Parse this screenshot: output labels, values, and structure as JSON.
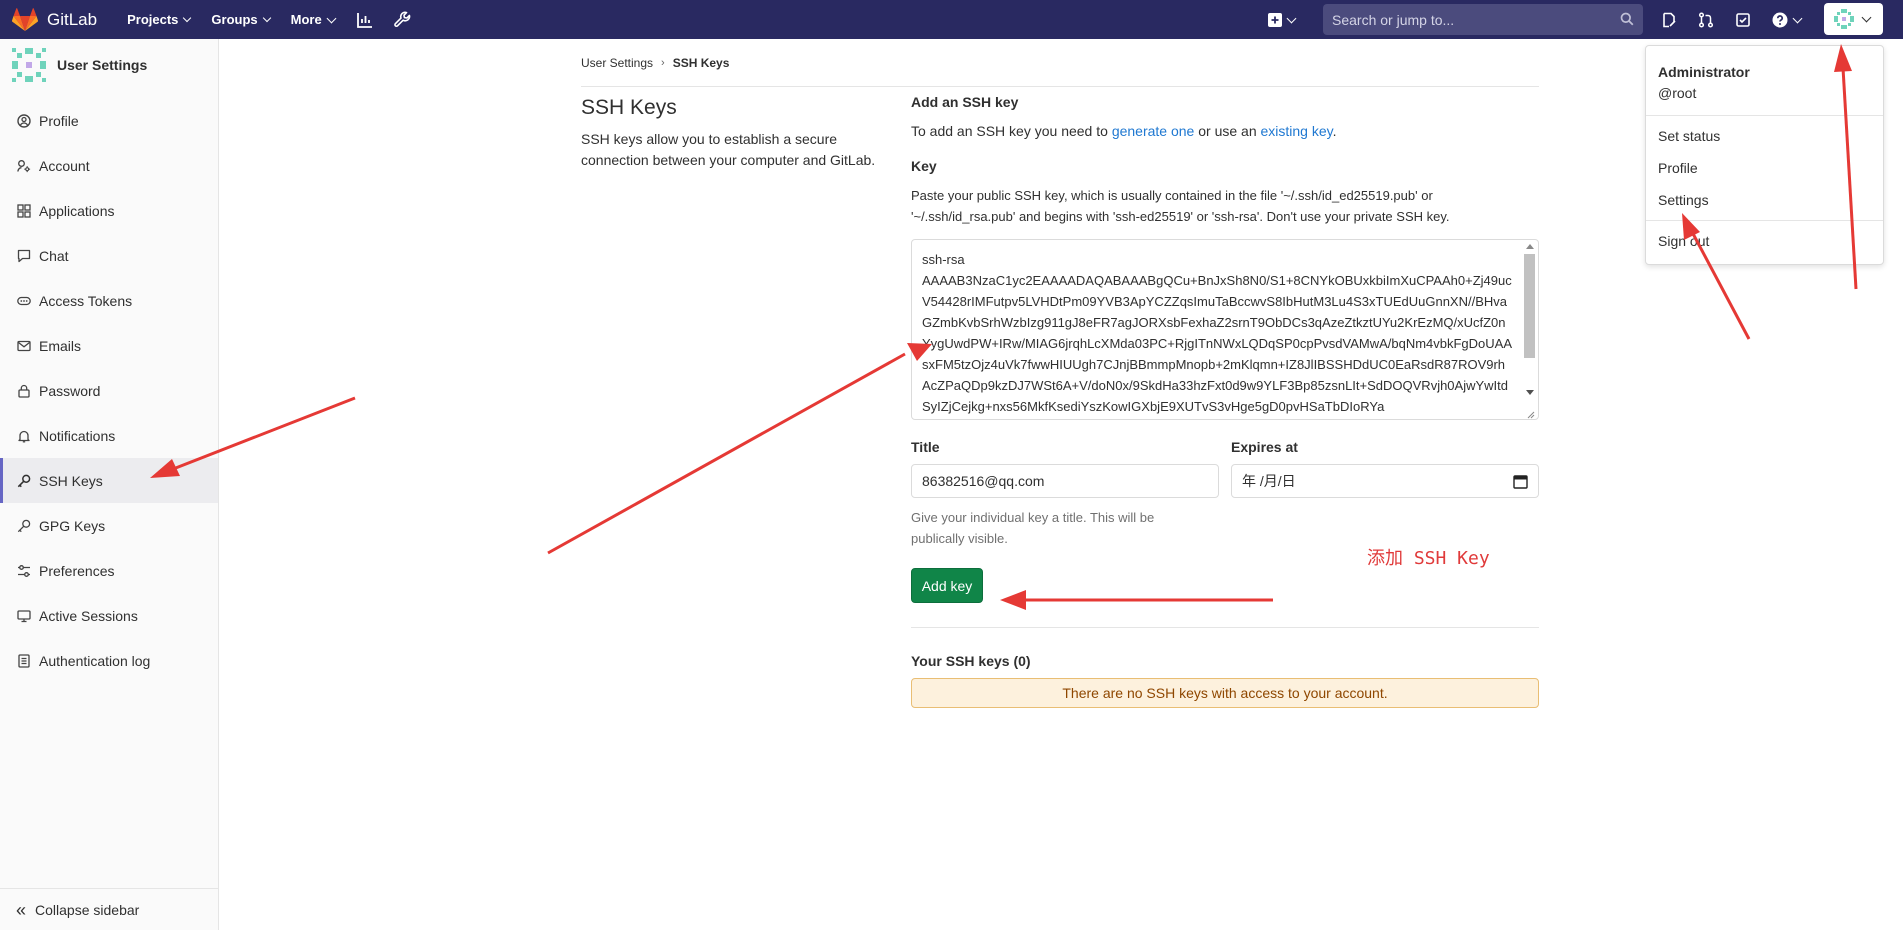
{
  "navbar": {
    "brand": "GitLab",
    "menu": [
      {
        "label": "Projects"
      },
      {
        "label": "Groups"
      },
      {
        "label": "More"
      }
    ],
    "search_placeholder": "Search or jump to...",
    "accent": "#292961"
  },
  "sidebar": {
    "title": "User Settings",
    "items": [
      {
        "label": "Profile",
        "icon": "profile-icon"
      },
      {
        "label": "Account",
        "icon": "account-icon"
      },
      {
        "label": "Applications",
        "icon": "applications-icon"
      },
      {
        "label": "Chat",
        "icon": "chat-icon"
      },
      {
        "label": "Access Tokens",
        "icon": "token-icon"
      },
      {
        "label": "Emails",
        "icon": "mail-icon"
      },
      {
        "label": "Password",
        "icon": "lock-icon"
      },
      {
        "label": "Notifications",
        "icon": "bell-icon"
      },
      {
        "label": "SSH Keys",
        "icon": "key-icon"
      },
      {
        "label": "GPG Keys",
        "icon": "key-icon"
      },
      {
        "label": "Preferences",
        "icon": "preferences-icon"
      },
      {
        "label": "Active Sessions",
        "icon": "monitor-icon"
      },
      {
        "label": "Authentication log",
        "icon": "log-icon"
      }
    ],
    "collapse_label": "Collapse sidebar"
  },
  "breadcrumb": {
    "parent": "User Settings",
    "current": "SSH Keys"
  },
  "page": {
    "title": "SSH Keys",
    "description": "SSH keys allow you to establish a secure connection between your computer and GitLab."
  },
  "form": {
    "heading": "Add an SSH key",
    "intro_prefix": "To add an SSH key you need to ",
    "intro_link1": "generate one",
    "intro_middle": " or use an ",
    "intro_link2": "existing key",
    "intro_suffix": ".",
    "key_label": "Key",
    "key_help": "Paste your public SSH key, which is usually contained in the file '~/.ssh/id_ed25519.pub' or '~/.ssh/id_rsa.pub' and begins with 'ssh-ed25519' or 'ssh-rsa'. Don't use your private SSH key.",
    "key_value": "ssh-rsa\nAAAAB3NzaC1yc2EAAAADAQABAAABgQCu+BnJxSh8N0/S1+8CNYkOBUxkbiImXuCPAAh0+Zj49ucV54428rIMFutpv5LVHDtPm09YVB3ApYCZZqsImuTaBccwvS8IbHutM3Lu4S3xTUEdUuGnnXN//BHvaGZmbKvbSrhWzbIzg911gJ8eFR7agJORXsbFexhaZ2srnT9ObDCs3qAzeZtkztUYu2KrEzMQ/xUcfZ0nYygUwdPW+IRw/MIAG6jrqhLcXMda03PC+RjgITnNWxLQDqSP0cpPvsdVAMwA/bqNm4vbkFgDoUAAsxFM5tzOjz4uVk7fwwHIUUgh7CJnjBBmmpMnopb+2mKlqmn+IZ8JlIBSSHDdUC0EaRsdR87ROV9rhAcZPaQDp9kzDJ7WSt6A+V/doN0x/9SkdHa33hzFxt0d9w9YLF3Bp85zsnLIt+SdDOQVRvjh0AjwYwItdSyIZjCejkg+nxs56MkfKsediYszKowIGXbjE9XUTvS3vHge5gD0pvHSaTbDIoRYa",
    "title_label": "Title",
    "title_value": "86382516@qq.com",
    "expires_label": "Expires at",
    "expires_value": "年 /月/日",
    "title_help": "Give your individual key a title. This will be publically visible.",
    "add_button": "Add key",
    "your_keys": "Your SSH keys (0)",
    "empty_message": "There are no SSH keys with access to your account.",
    "button_color": "#108548"
  },
  "annotation": "添加 SSH Key",
  "dropdown": {
    "name": "Administrator",
    "username": "@root",
    "items": [
      "Set status",
      "Profile",
      "Settings",
      "Sign out"
    ]
  }
}
